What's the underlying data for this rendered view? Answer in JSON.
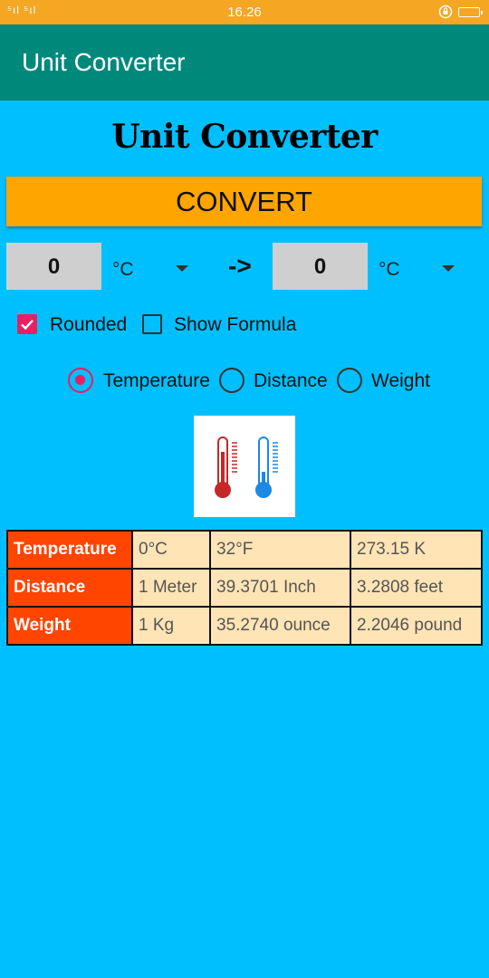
{
  "status_bar": {
    "signal": "⁵ıl ⁵ıl",
    "time": "16.26"
  },
  "app_bar": {
    "title": "Unit Converter"
  },
  "heading": "Unit Converter",
  "convert_button": "CONVERT",
  "from": {
    "value": "0",
    "unit": "°C"
  },
  "arrow": "->",
  "to": {
    "value": "0",
    "unit": "°C"
  },
  "options": {
    "rounded": {
      "label": "Rounded",
      "checked": true
    },
    "show_formula": {
      "label": "Show Formula",
      "checked": false
    }
  },
  "categories": [
    {
      "label": "Temperature",
      "selected": true
    },
    {
      "label": "Distance",
      "selected": false
    },
    {
      "label": "Weight",
      "selected": false
    }
  ],
  "table": {
    "rows": [
      [
        "Temperature",
        "0°C",
        "32°F",
        "273.15 K"
      ],
      [
        "Distance",
        "1 Meter",
        "39.3701 Inch",
        "3.2808 feet"
      ],
      [
        "Weight",
        "1 Kg",
        "35.2740 ounce",
        "2.2046 pound"
      ]
    ]
  },
  "colors": {
    "background": "#00BFFF",
    "app_bar": "#00897B",
    "accent": "#E91E63",
    "button": "#FFA500",
    "table_header": "#FF4500",
    "table_cell": "#FFE4B5"
  }
}
